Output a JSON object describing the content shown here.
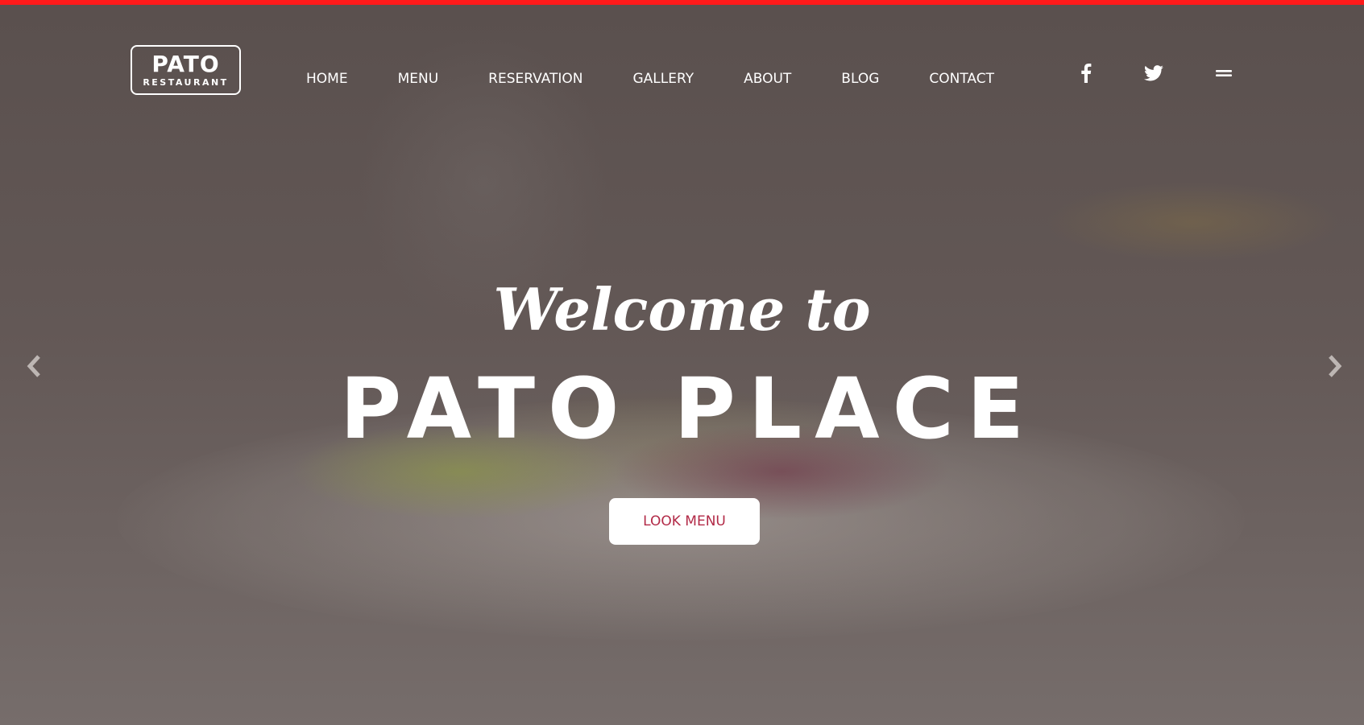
{
  "logo": {
    "main": "PATO",
    "sub": "RESTAURANT"
  },
  "nav": {
    "items": [
      {
        "label": "HOME"
      },
      {
        "label": "MENU"
      },
      {
        "label": "RESERVATION"
      },
      {
        "label": "GALLERY"
      },
      {
        "label": "ABOUT"
      },
      {
        "label": "BLOG"
      },
      {
        "label": "CONTACT"
      }
    ],
    "social_icons": [
      "facebook-icon",
      "twitter-icon",
      "hamburger-menu-icon"
    ]
  },
  "hero": {
    "welcome": "Welcome to",
    "title": "PATO PLACE",
    "cta_label": "LOOK MENU"
  },
  "carousel": {
    "prev_icon": "chevron-left-icon",
    "next_icon": "chevron-right-icon"
  },
  "colors": {
    "accent_bar": "#ff1a1a",
    "cta_text": "#b22a47",
    "text": "#ffffff",
    "overlay": "#5f5552"
  }
}
